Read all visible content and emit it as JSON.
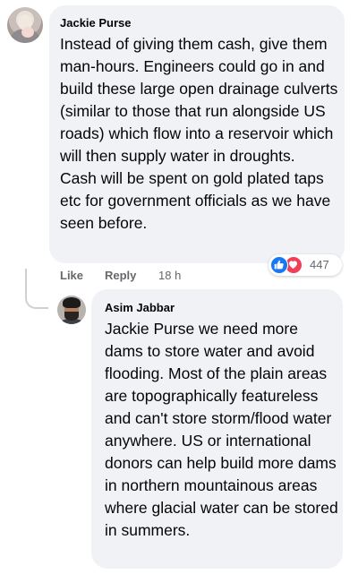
{
  "comment": {
    "author": "Jackie Purse",
    "paragraphs": [
      "Instead of giving them cash, give them man-hours. Engineers could go in and build these large open drainage culverts (similar to those that run alongside US roads) which flow into a reservoir which will then supply water in droughts.",
      "Cash will be spent on gold plated taps etc for government officials as we have seen before."
    ],
    "actions": {
      "like_label": "Like",
      "reply_label": "Reply",
      "timestamp": "18 h"
    },
    "reactions": {
      "icons": [
        "like-icon",
        "love-icon"
      ],
      "count": "447",
      "colors": {
        "like": "#1877f2",
        "love": "#f33e58"
      }
    }
  },
  "reply": {
    "author": "Asim Jabbar",
    "text": "Jackie Purse we need more dams to store water and avoid flooding. Most of the plain areas are topographically featureless and can't store storm/flood water anywhere. US or international donors can help build more dams in northern mountainous areas where glacial water can be stored in summers."
  },
  "colors": {
    "bubble_bg": "#f0f2f5",
    "text": "#050505",
    "meta": "#65676b",
    "connector": "#ced0d4"
  }
}
